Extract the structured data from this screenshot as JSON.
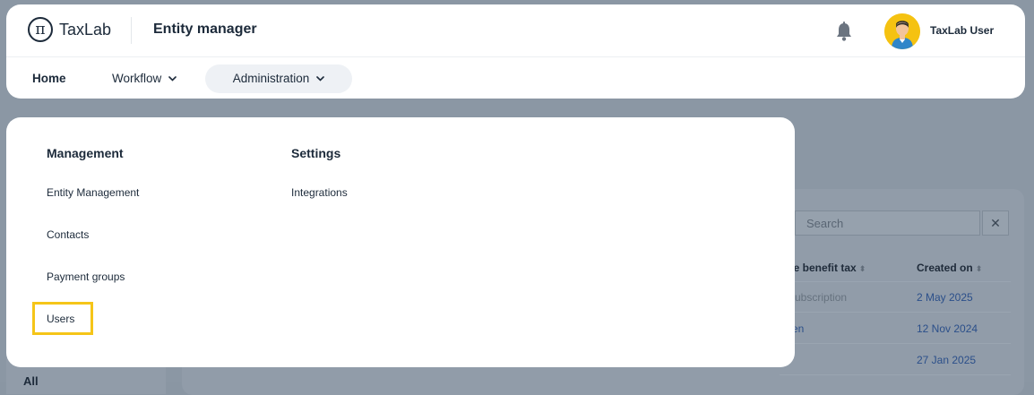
{
  "header": {
    "logo_text": "TaxLab",
    "app_title": "Entity manager",
    "user_name": "TaxLab User"
  },
  "nav": {
    "home": "Home",
    "workflow": "Workflow",
    "administration": "Administration"
  },
  "dropdown": {
    "groups": [
      {
        "title": "Management",
        "items": [
          "Entity Management",
          "Contacts",
          "Payment groups",
          "Users"
        ]
      },
      {
        "title": "Settings",
        "items": [
          "Integrations"
        ]
      }
    ],
    "highlighted_item": "Users"
  },
  "background": {
    "search_placeholder": "Search",
    "clear_label": "✕",
    "columns": [
      "nge benefit tax",
      "Created on"
    ],
    "rows": [
      {
        "col1": "d subscription",
        "created": "2 May 2025"
      },
      {
        "col1": "en",
        "created": "12 Nov 2024"
      },
      {
        "col1": "",
        "created": "27 Jan 2025"
      }
    ],
    "side_label": "All"
  },
  "icons": {
    "bell": "bell-icon",
    "avatar": "user-avatar",
    "chevron": "chevron-down-icon",
    "logo": "pi-logo-icon"
  },
  "colors": {
    "highlight": "#f5c518",
    "avatar_bg": "#f5c211",
    "link_blue": "#2b4f8a"
  }
}
